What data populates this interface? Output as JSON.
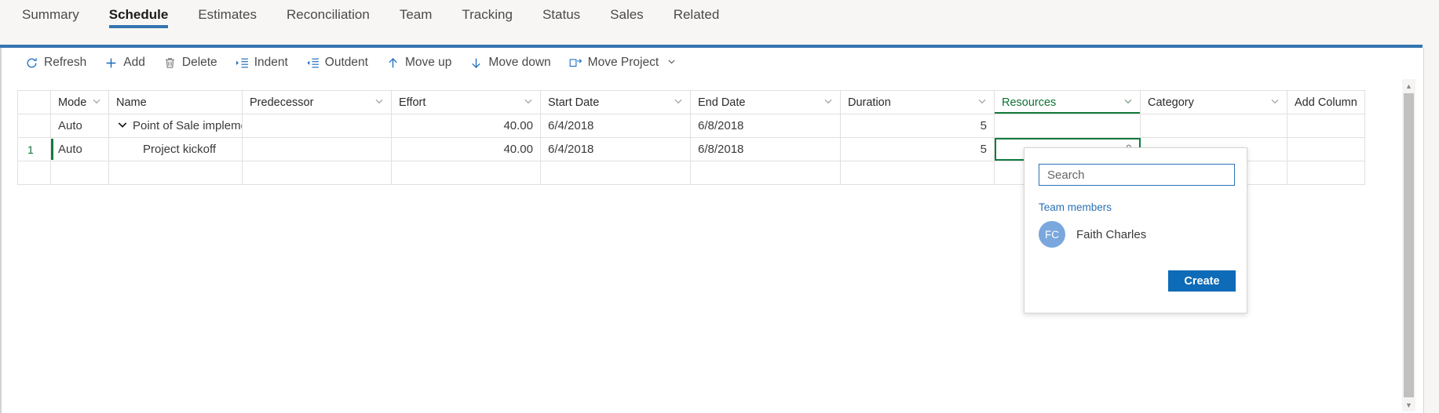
{
  "tabs": [
    {
      "label": "Summary",
      "active": false
    },
    {
      "label": "Schedule",
      "active": true
    },
    {
      "label": "Estimates",
      "active": false
    },
    {
      "label": "Reconciliation",
      "active": false
    },
    {
      "label": "Team",
      "active": false
    },
    {
      "label": "Tracking",
      "active": false
    },
    {
      "label": "Status",
      "active": false
    },
    {
      "label": "Sales",
      "active": false
    },
    {
      "label": "Related",
      "active": false
    }
  ],
  "toolbar": {
    "refresh": "Refresh",
    "add": "Add",
    "delete": "Delete",
    "indent": "Indent",
    "outdent": "Outdent",
    "move_up": "Move up",
    "move_down": "Move down",
    "move_project": "Move Project"
  },
  "grid": {
    "columns": [
      {
        "key": "idx",
        "label": "",
        "sortable": false,
        "selected": false
      },
      {
        "key": "mode",
        "label": "Mode",
        "sortable": true,
        "selected": false
      },
      {
        "key": "name",
        "label": "Name",
        "sortable": false,
        "selected": false
      },
      {
        "key": "pred",
        "label": "Predecessor",
        "sortable": true,
        "selected": false
      },
      {
        "key": "eff",
        "label": "Effort",
        "sortable": true,
        "selected": false
      },
      {
        "key": "start",
        "label": "Start Date",
        "sortable": true,
        "selected": false
      },
      {
        "key": "end",
        "label": "End Date",
        "sortable": true,
        "selected": false
      },
      {
        "key": "dur",
        "label": "Duration",
        "sortable": true,
        "selected": false
      },
      {
        "key": "res",
        "label": "Resources",
        "sortable": true,
        "selected": true
      },
      {
        "key": "cat",
        "label": "Category",
        "sortable": true,
        "selected": false
      },
      {
        "key": "add",
        "label": "Add Column",
        "sortable": false,
        "selected": false
      }
    ],
    "rows": [
      {
        "idx": "",
        "mode": "Auto",
        "name": "Point of Sale implementati",
        "pred": "",
        "eff": "40.00",
        "start": "6/4/2018",
        "end": "6/8/2018",
        "dur": "5",
        "res": "",
        "cat": ""
      },
      {
        "idx": "1",
        "mode": "Auto",
        "name": "Project kickoff",
        "pred": "",
        "eff": "40.00",
        "start": "6/4/2018",
        "end": "6/8/2018",
        "dur": "5",
        "res": "",
        "cat": ""
      },
      {
        "idx": "",
        "mode": "",
        "name": "",
        "pred": "",
        "eff": "",
        "start": "",
        "end": "",
        "dur": "",
        "res": "",
        "cat": ""
      }
    ]
  },
  "resource_popup": {
    "search_value": "",
    "search_placeholder": "Search",
    "group_label": "Team members",
    "members": [
      {
        "initials": "FC",
        "name": "Faith Charles"
      }
    ],
    "create_label": "Create"
  },
  "colors": {
    "accent_blue": "#3575b0",
    "link_blue": "#1568bf",
    "selection_green": "#107c41",
    "button_blue": "#0d6bb7",
    "avatar_blue": "#7aa7dd"
  }
}
